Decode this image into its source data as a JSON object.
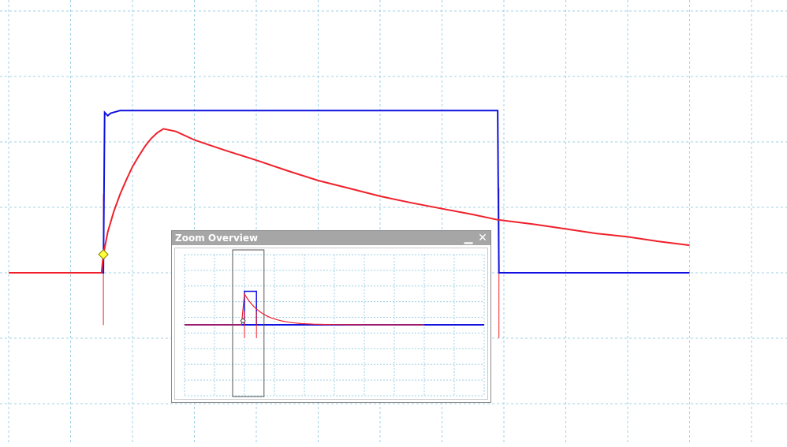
{
  "window": {
    "title": "Zoom Overview",
    "minimize_glyph": "▁",
    "close_glyph": "✕"
  },
  "colors": {
    "background": "#ffffff",
    "grid": "#9fd0e6",
    "channel_a": "#1010e0",
    "channel_b": "#f0202a",
    "trigger_marker_fill": "#ffff3a",
    "trigger_marker_stroke": "#808000",
    "titlebar": "#a6a6a6"
  },
  "icons": {
    "trigger": "diamond-marker-icon",
    "minimize": "minimize-icon",
    "close": "close-icon"
  },
  "chart_data": {
    "type": "line",
    "grid": true,
    "x_divisions": 11,
    "y_divisions": 7,
    "series": [
      {
        "color": "#1010e0",
        "points": [
          [
            0.0,
            0.0
          ],
          [
            1.53,
            0.0
          ],
          [
            1.55,
            2.45
          ],
          [
            1.6,
            2.4
          ],
          [
            1.65,
            2.44
          ],
          [
            1.8,
            2.48
          ],
          [
            2.0,
            2.48
          ],
          [
            7.9,
            2.48
          ],
          [
            7.92,
            0.0
          ],
          [
            11.0,
            0.0
          ]
        ]
      },
      {
        "color": "#f0202a",
        "points": [
          [
            0.0,
            0.0
          ],
          [
            1.5,
            0.0
          ],
          [
            1.53,
            0.28
          ],
          [
            1.6,
            0.62
          ],
          [
            1.7,
            0.94
          ],
          [
            1.8,
            1.2
          ],
          [
            1.9,
            1.42
          ],
          [
            2.0,
            1.62
          ],
          [
            2.1,
            1.78
          ],
          [
            2.2,
            1.93
          ],
          [
            2.3,
            2.05
          ],
          [
            2.4,
            2.14
          ],
          [
            2.5,
            2.2
          ],
          [
            2.7,
            2.16
          ],
          [
            3.0,
            2.03
          ],
          [
            3.5,
            1.87
          ],
          [
            4.0,
            1.72
          ],
          [
            4.5,
            1.56
          ],
          [
            5.0,
            1.41
          ],
          [
            5.5,
            1.29
          ],
          [
            6.0,
            1.17
          ],
          [
            6.5,
            1.07
          ],
          [
            7.0,
            0.98
          ],
          [
            7.5,
            0.89
          ],
          [
            7.9,
            0.81
          ],
          [
            8.5,
            0.74
          ],
          [
            9.0,
            0.67
          ],
          [
            9.5,
            0.6
          ],
          [
            10.0,
            0.55
          ],
          [
            10.5,
            0.48
          ],
          [
            11.0,
            0.42
          ]
        ]
      }
    ],
    "trigger": {
      "x": 1.53,
      "y": 0.28
    },
    "overview": {
      "x_range": [
        0,
        100
      ],
      "selection": [
        0,
        11
      ]
    }
  }
}
